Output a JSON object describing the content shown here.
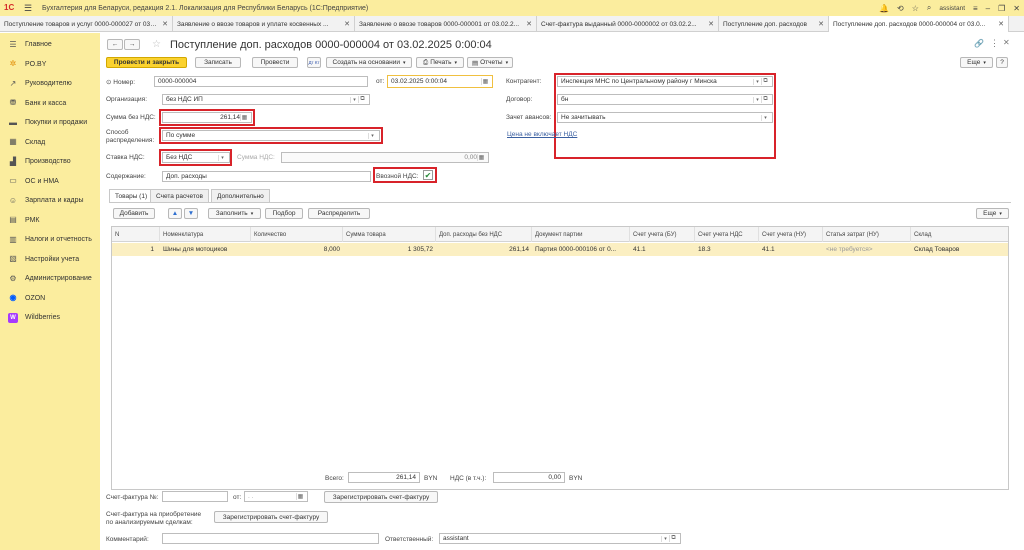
{
  "app": {
    "title": "Бухгалтерия для Беларуси, редакция 2.1. Локализация для Республики Беларусь   (1С:Предприятие)",
    "user": "assistant"
  },
  "tabs": [
    "Поступление товаров и услуг 0000-000027 от 03.02....",
    "Заявление о ввозе товаров и уплате косвенных ...",
    "Заявление о ввозе товаров 0000-000001 от 03.02.2...",
    "Счет-фактура выданный 0000-0000002 от 03.02.2...",
    "Поступление доп. расходов",
    "Поступление доп. расходов 0000-000004 от 03.0..."
  ],
  "sidebar": [
    {
      "label": "Главное",
      "icon": "menu-icon"
    },
    {
      "label": "PO.BY",
      "icon": "sun-icon"
    },
    {
      "label": "Руководителю",
      "icon": "chart-icon"
    },
    {
      "label": "Банк и касса",
      "icon": "bank-icon"
    },
    {
      "label": "Покупки и продажи",
      "icon": "cart-icon"
    },
    {
      "label": "Склад",
      "icon": "warehouse-icon"
    },
    {
      "label": "Производство",
      "icon": "factory-icon"
    },
    {
      "label": "ОС и НМА",
      "icon": "truck-icon"
    },
    {
      "label": "Зарплата и кадры",
      "icon": "people-icon"
    },
    {
      "label": "РМК",
      "icon": "register-icon"
    },
    {
      "label": "Налоги и отчетность",
      "icon": "report-icon"
    },
    {
      "label": "Настройки учета",
      "icon": "settings-doc-icon"
    },
    {
      "label": "Администрирование",
      "icon": "gear-icon"
    },
    {
      "label": "OZON",
      "icon": "ozon-icon"
    },
    {
      "label": "Wildberries",
      "icon": "wb-icon"
    }
  ],
  "doc": {
    "title": "Поступление доп. расходов 0000-000004 от 03.02.2025 0:00:04",
    "toolbar": {
      "post_close": "Провести и закрыть",
      "save": "Записать",
      "post": "Провести",
      "dt_kt": "Дт Кт",
      "create_based": "Создать на основании",
      "print": "Печать",
      "reports": "Отчеты",
      "more": "Еще"
    },
    "number_label": "Номер:",
    "number": "0000-000004",
    "date_label": "от:",
    "date": "03.02.2025  0:00:04",
    "org_label": "Организация:",
    "org": "без НДС ИП",
    "sum_label": "Сумма без НДС:",
    "sum": "261,14",
    "method_label_1": "Способ",
    "method_label_2": "распределения:",
    "method": "По сумме",
    "vat_rate_label": "Ставка НДС:",
    "vat_rate": "Без НДС",
    "vat_sum_label": "Сумма НДС:",
    "vat_sum": "0,00",
    "content_label": "Содержание:",
    "content": "Доп. расходы",
    "import_vat_label": "Ввозной НДС:",
    "counterparty_label": "Контрагент:",
    "counterparty": "Инспекция МНС по Центральному району г Минска",
    "contract_label": "Договор:",
    "contract": "бн",
    "advance_label": "Зачет авансов:",
    "advance": "Не зачитывать",
    "price_link": "Цена не включает НДС"
  },
  "inner_tabs": [
    "Товары (1)",
    "Счета расчетов",
    "Дополнительно"
  ],
  "grid_toolbar": {
    "add": "Добавить",
    "fill": "Заполнить",
    "pick": "Подбор",
    "distribute": "Распределить",
    "more": "Еще"
  },
  "table": {
    "headers": [
      "N",
      "Номенклатура",
      "Количество",
      "Сумма товара",
      "Доп. расходы без НДС",
      "Документ партии",
      "Счет учета (БУ)",
      "Счет учета НДС",
      "Счет учета (НУ)",
      "Статья затрат (НУ)",
      "Склад"
    ],
    "rows": [
      [
        "1",
        "Шины для мотоциков",
        "8,000",
        "1 305,72",
        "261,14",
        "Партия 0000-000106 от 0...",
        "41.1",
        "18.3",
        "41.1",
        "<не требуется>",
        "Склад Товаров"
      ]
    ]
  },
  "totals": {
    "total_label": "Всего:",
    "total": "261,14",
    "currency": "BYN",
    "vat_label": "НДС (в т.ч.):",
    "vat": "0,00"
  },
  "footer": {
    "invoice_label": "Счет-фактура №:",
    "invoice_from": "от:",
    "invoice_date_placeholder": ". .",
    "register_invoice": "Зарегистрировать счет-фактуру",
    "invoice_analyzed_1": "Счет-фактура на приобретение",
    "invoice_analyzed_2": "по анализируемым сделкам:",
    "register_invoice_2": "Зарегистрировать счет-фактуру",
    "comment_label": "Комментарий:",
    "responsible_label": "Ответственный:",
    "responsible": "assistant"
  },
  "colors": {
    "accent": "#fbed9e",
    "primary_button": "#fbd22e",
    "highlight": "#d8232a",
    "selected_row": "#fbefc2"
  }
}
